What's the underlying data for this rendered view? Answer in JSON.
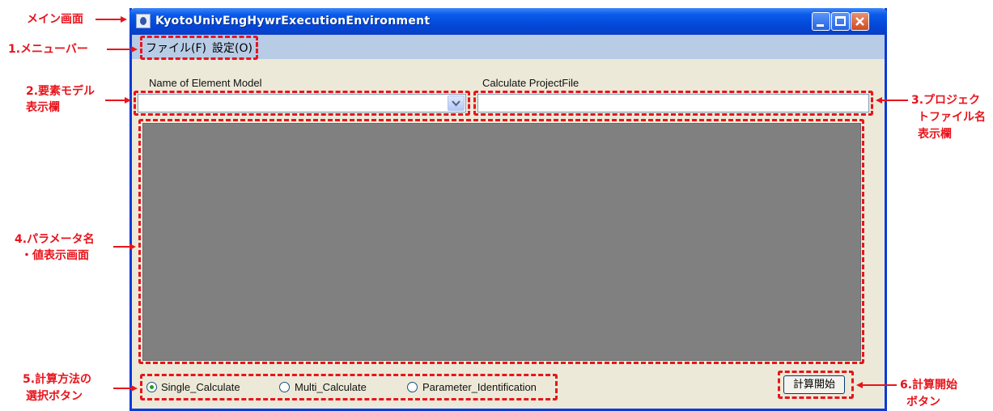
{
  "window": {
    "title": "KyotoUnivEngHywrExecutionEnvironment"
  },
  "menu": {
    "file": "ファイル(F)",
    "settings": "設定(O)"
  },
  "fields": {
    "element_model_label": "Name of Element Model",
    "project_file_label": "Calculate ProjectFile",
    "element_model_value": "",
    "project_file_value": ""
  },
  "calc_modes": {
    "options": [
      "Single_Calculate",
      "Multi_Calculate",
      "Parameter_Identification"
    ],
    "selected": "Single_Calculate"
  },
  "start_button": "計算開始",
  "annotations": {
    "main_screen": "メイン画面",
    "menu_bar": "1.メニューバー",
    "element_model_line1": "2.要素モデル",
    "element_model_line2": "表示欄",
    "project_file_line1": "3.プロジェク",
    "project_file_line2": "トファイル名",
    "project_file_line3": "表示欄",
    "param_line1": "4.パラメータ名",
    "param_line2": "・値表示画面",
    "calc_method_line1": "5.計算方法の",
    "calc_method_line2": "選択ボタン",
    "start_line1": "6.計算開始",
    "start_line2": "ボタン"
  },
  "colors": {
    "annotation": "#e8141c",
    "title_bar": "#0a5ae9",
    "window_bg": "#ece9d8",
    "menu_bar": "#b8cce6",
    "grid": "#808080"
  },
  "icons": [
    "app-icon",
    "minimize-icon",
    "maximize-icon",
    "close-icon",
    "chevron-down-icon",
    "radio-icon"
  ]
}
